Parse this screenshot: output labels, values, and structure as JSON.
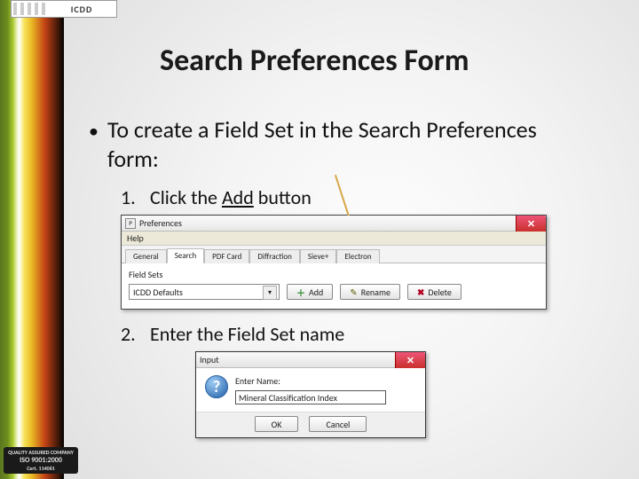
{
  "logo_text": "ICDD",
  "iso_badge": {
    "line1": "QUALITY ASSURED COMPANY",
    "line2": "ISO 9001:2000",
    "line3": "Cert. 114061"
  },
  "title": "Search Preferences Form",
  "bullet_intro": "To create a Field Set in the Search Preferences form:",
  "steps": [
    {
      "num": "1.",
      "before": "Click the ",
      "em": "Add",
      "after": " button"
    },
    {
      "num": "2.",
      "before": "Enter the Field Set name",
      "em": "",
      "after": ""
    }
  ],
  "pref_dialog": {
    "title": "Preferences",
    "menu": "Help",
    "tabs": [
      "General",
      "Search",
      "PDF Card",
      "Diffraction",
      "Sieve+",
      "Electron"
    ],
    "active_tab": 1,
    "group_label": "Field Sets",
    "dropdown_value": "ICDD Defaults",
    "buttons": {
      "add": "Add",
      "rename": "Rename",
      "delete": "Delete"
    }
  },
  "input_dialog": {
    "title": "Input",
    "prompt": "Enter Name:",
    "value": "Mineral Classification Index",
    "ok": "OK",
    "cancel": "Cancel"
  }
}
